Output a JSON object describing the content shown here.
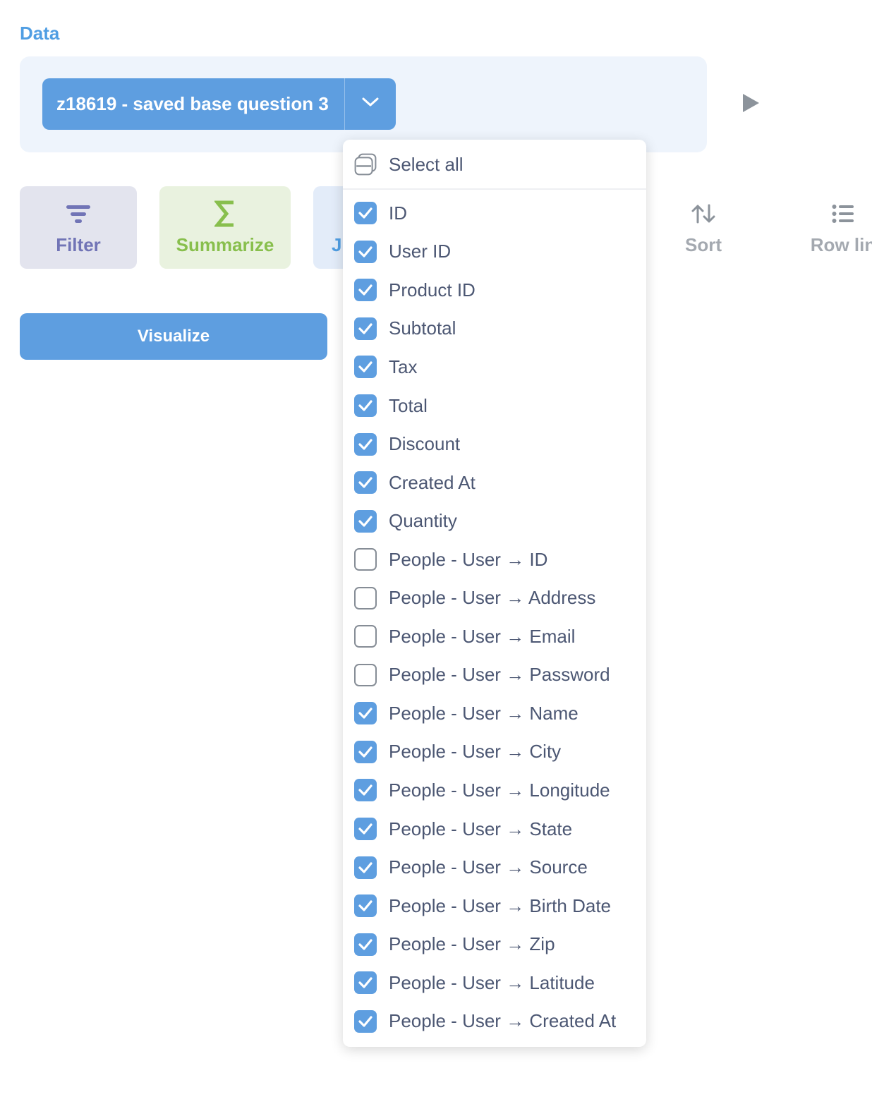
{
  "section_label": "Data",
  "source": {
    "name": "z18619 - saved base question 3"
  },
  "actions": {
    "filter": "Filter",
    "summarize": "Summarize",
    "join": "J",
    "sort": "Sort",
    "row_limit": "Row lin"
  },
  "visualize_label": "Visualize",
  "column_picker": {
    "select_all_label": "Select all",
    "columns": [
      {
        "label": "ID",
        "checked": true
      },
      {
        "label": "User ID",
        "checked": true
      },
      {
        "label": "Product ID",
        "checked": true
      },
      {
        "label": "Subtotal",
        "checked": true
      },
      {
        "label": "Tax",
        "checked": true
      },
      {
        "label": "Total",
        "checked": true
      },
      {
        "label": "Discount",
        "checked": true
      },
      {
        "label": "Created At",
        "checked": true
      },
      {
        "label": "Quantity",
        "checked": true
      },
      {
        "label": "People - User → ID",
        "checked": false
      },
      {
        "label": "People - User → Address",
        "checked": false
      },
      {
        "label": "People - User → Email",
        "checked": false
      },
      {
        "label": "People - User → Password",
        "checked": false
      },
      {
        "label": "People - User → Name",
        "checked": true
      },
      {
        "label": "People - User → City",
        "checked": true
      },
      {
        "label": "People - User → Longitude",
        "checked": true
      },
      {
        "label": "People - User → State",
        "checked": true
      },
      {
        "label": "People - User → Source",
        "checked": true
      },
      {
        "label": "People - User → Birth Date",
        "checked": true
      },
      {
        "label": "People - User → Zip",
        "checked": true
      },
      {
        "label": "People - User → Latitude",
        "checked": true
      },
      {
        "label": "People - User → Created At",
        "checked": true
      }
    ]
  },
  "colors": {
    "brand": "#509ee3",
    "filter": "#7174b6",
    "summarize": "#88bf4d",
    "text": "#4c5773"
  }
}
